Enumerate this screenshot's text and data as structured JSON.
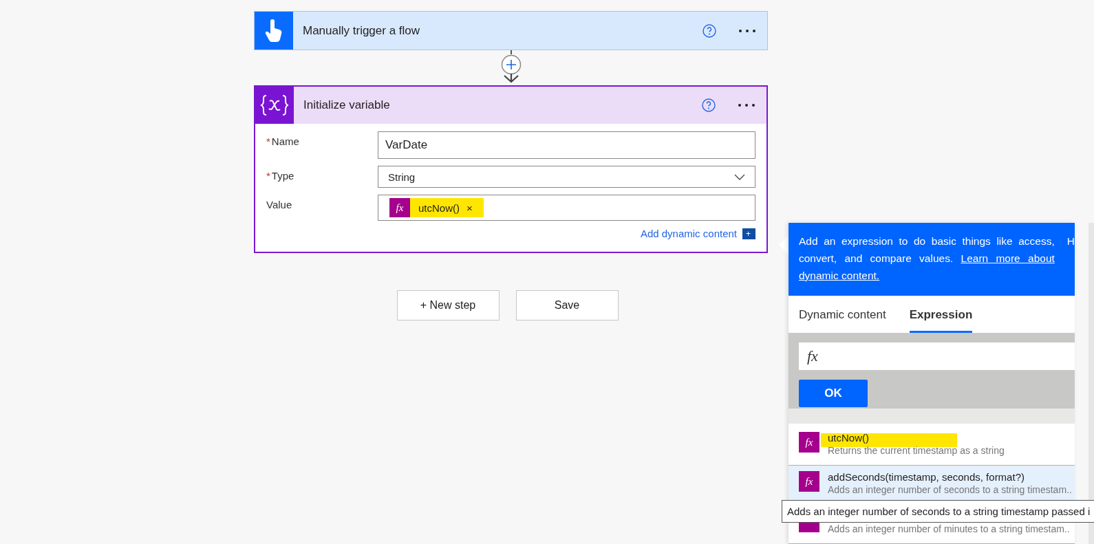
{
  "trigger": {
    "title": "Manually trigger a flow"
  },
  "action": {
    "title": "Initialize variable",
    "fields": [
      {
        "kind": "text",
        "label": "Name",
        "mark": "*",
        "value": "VarDate"
      },
      {
        "kind": "select",
        "label": "Type",
        "mark": "*",
        "value": "String"
      },
      {
        "kind": "token",
        "label": "Value",
        "icon": "fx",
        "token": "utcNow()",
        "remove": "×",
        "highlighted": true
      }
    ],
    "add_dynamic": "Add dynamic content",
    "add_icon": "+"
  },
  "buttons": [
    {
      "label": "+ New step"
    },
    {
      "label": "Save"
    }
  ],
  "panel": {
    "info": "Add an expression to do basic things like access, convert, and compare values.",
    "link": [
      "Learn more about",
      "dynamic content."
    ],
    "cut_text": "H",
    "tabs": [
      {
        "label": "Dynamic content",
        "selected": false
      },
      {
        "label": "Expression",
        "selected": true
      }
    ],
    "expression_icon": "fx",
    "ok": "OK",
    "functions": [
      {
        "icon": "fx",
        "name": "utcNow()",
        "description": "Returns the current timestamp as a string",
        "hovered": false,
        "highlighted": true
      },
      {
        "icon": "fx",
        "name": "addSeconds(timestamp, seconds, format?)",
        "description": "Adds an integer number of seconds to a string timestam..",
        "hovered": true,
        "highlighted": false
      },
      {
        "description": "Adds an integer number of minutes to a string timestam..",
        "hovered": false,
        "highlighted": false
      }
    ],
    "tooltip": "Adds an integer number of seconds to a string timestamp passed i"
  }
}
